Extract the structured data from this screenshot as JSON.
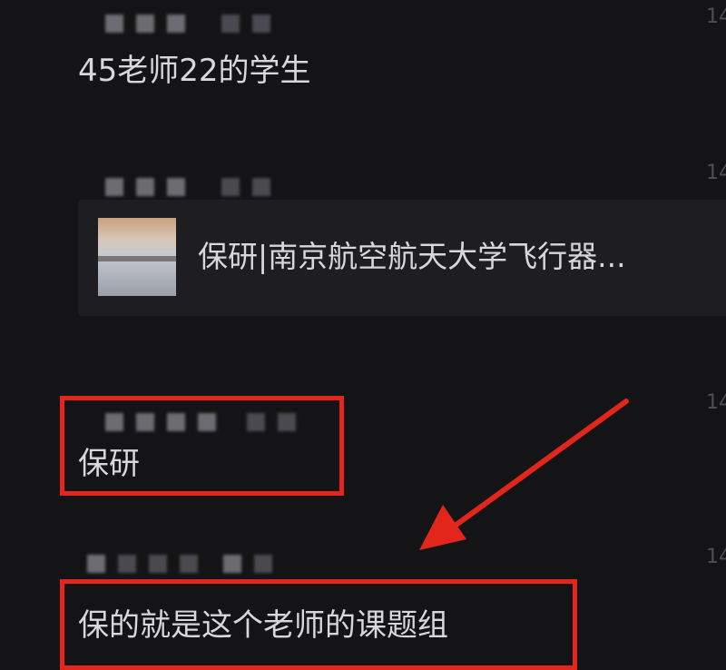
{
  "messages": [
    {
      "text": "45老师22的学生"
    },
    {
      "card_title": "保研|南京航空航天大学飞行器..."
    },
    {
      "text": "保研"
    },
    {
      "text": "保的就是这个老师的课题组"
    }
  ],
  "time_partial": "14",
  "colors": {
    "background": "#141417",
    "highlight": "#e2261c",
    "text": "#d9d9dc"
  }
}
